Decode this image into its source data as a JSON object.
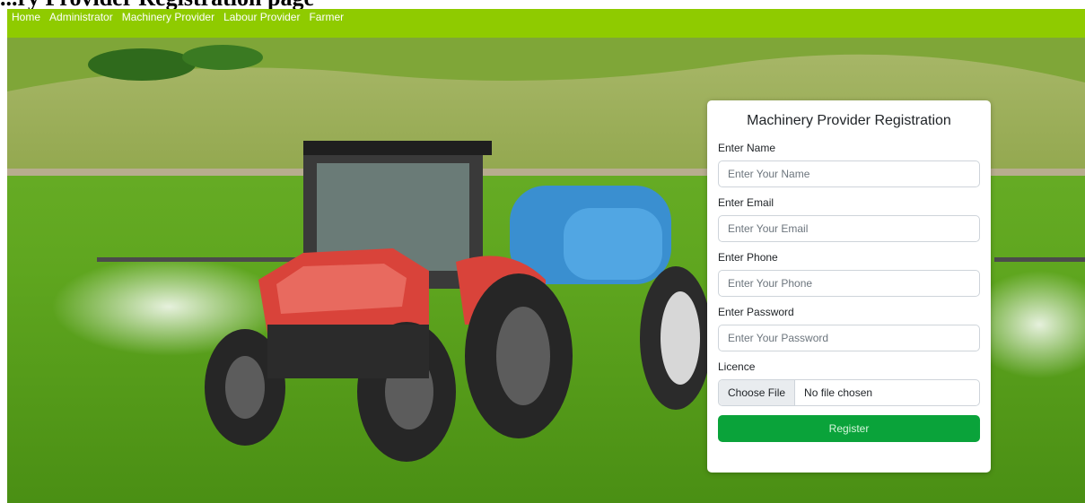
{
  "page": {
    "caption": "...ry Provider Registration page"
  },
  "nav": {
    "items": [
      "Home",
      "Administrator",
      "Machinery Provider",
      "Labour Provider",
      "Farmer"
    ]
  },
  "form": {
    "title": "Machinery Provider Registration",
    "name_label": "Enter Name",
    "name_placeholder": "Enter Your Name",
    "email_label": "Enter Email",
    "email_placeholder": "Enter Your Email",
    "phone_label": "Enter Phone",
    "phone_placeholder": "Enter Your Phone",
    "password_label": "Enter Password",
    "password_placeholder": "Enter Your Password",
    "licence_label": "Licence",
    "file_button": "Choose File",
    "file_status": "No file chosen",
    "submit_label": "Register"
  },
  "colors": {
    "navbar": "#8fcb00",
    "register_button": "#0aa33a"
  }
}
